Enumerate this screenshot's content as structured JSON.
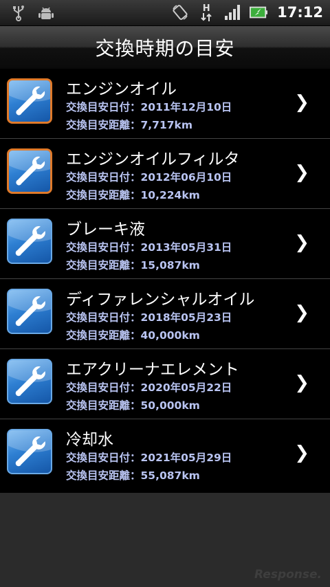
{
  "status_bar": {
    "time": "17:12",
    "icons": [
      "usb-icon",
      "android-debug-icon",
      "rotate-icon",
      "hspa-data-icon",
      "signal-icon",
      "battery-charging-icon"
    ],
    "hspa_label": "H"
  },
  "header": {
    "title": "交換時期の目安"
  },
  "items": [
    {
      "name": "エンジンオイル",
      "date_line": "交換目安日付：2011年12月10日",
      "distance_line": "交換目安距離：7,717km",
      "alert": true
    },
    {
      "name": "エンジンオイルフィルタ",
      "date_line": "交換目安日付：2012年06月10日",
      "distance_line": "交換目安距離：10,224km",
      "alert": true
    },
    {
      "name": "ブレーキ液",
      "date_line": "交換目安日付：2013年05月31日",
      "distance_line": "交換目安距離：15,087km",
      "alert": false
    },
    {
      "name": "ディファレンシャルオイル",
      "date_line": "交換目安日付：2018年05月23日",
      "distance_line": "交換目安距離：40,000km",
      "alert": false
    },
    {
      "name": "エアクリーナエレメント",
      "date_line": "交換目安日付：2020年05月22日",
      "distance_line": "交換目安距離：50,000km",
      "alert": false
    },
    {
      "name": "冷却水",
      "date_line": "交換目安日付：2021年05月29日",
      "distance_line": "交換目安距離：55,087km",
      "alert": false
    }
  ],
  "chevron": "❯",
  "watermark": "Response."
}
